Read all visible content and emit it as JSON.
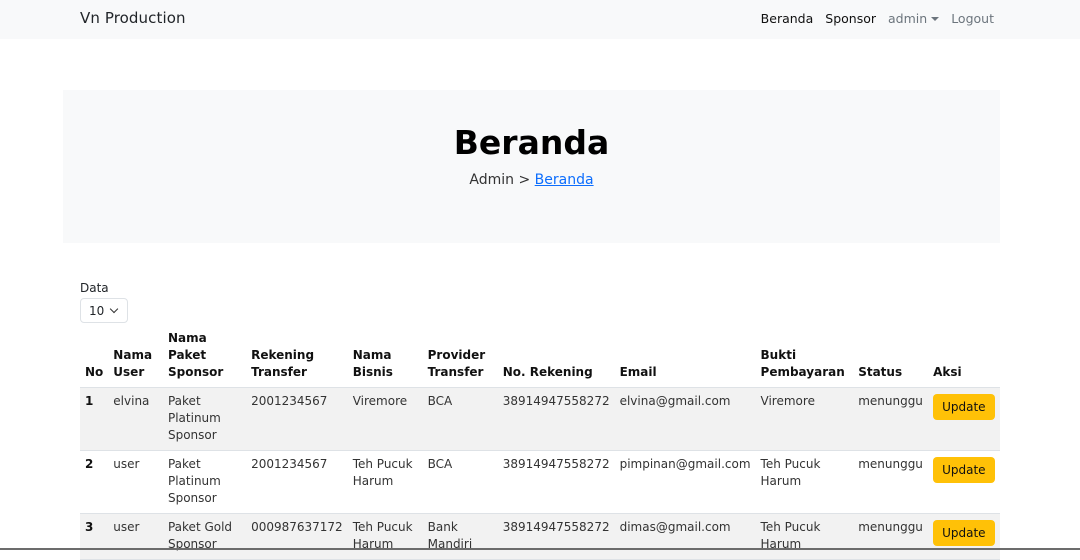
{
  "navbar": {
    "brand": "Vn Production",
    "links": {
      "beranda": "Beranda",
      "sponsor": "Sponsor",
      "admin": "admin",
      "logout": "Logout"
    }
  },
  "hero": {
    "title": "Beranda",
    "breadcrumb_root": "Admin",
    "breadcrumb_sep": " > ",
    "breadcrumb_current": "Beranda"
  },
  "table_controls": {
    "data_label": "Data",
    "page_size": "10"
  },
  "table": {
    "headers": [
      "No",
      "Nama User",
      "Nama Paket Sponsor",
      "Rekening Transfer",
      "Nama Bisnis",
      "Provider Transfer",
      "No. Rekening",
      "Email",
      "Bukti Pembayaran",
      "Status",
      "Aksi"
    ],
    "rows": [
      {
        "no": "1",
        "user": "elvina",
        "paket": "Paket Platinum Sponsor",
        "rekening": "2001234567",
        "bisnis": "Viremore",
        "provider": "BCA",
        "no_rek": "38914947558272",
        "email": "elvina@gmail.com",
        "bukti": "Viremore",
        "status": "menunggu",
        "aksi": "Update"
      },
      {
        "no": "2",
        "user": "user",
        "paket": "Paket Platinum Sponsor",
        "rekening": "2001234567",
        "bisnis": "Teh Pucuk Harum",
        "provider": "BCA",
        "no_rek": "38914947558272",
        "email": "pimpinan@gmail.com",
        "bukti": "Teh Pucuk Harum",
        "status": "menunggu",
        "aksi": "Update"
      },
      {
        "no": "3",
        "user": "user",
        "paket": "Paket Gold Sponsor",
        "rekening": "000987637172",
        "bisnis": "Teh Pucuk Harum",
        "provider": "Bank Mandiri",
        "no_rek": "38914947558272",
        "email": "dimas@gmail.com",
        "bukti": "Teh Pucuk Harum",
        "status": "menunggu",
        "aksi": "Update"
      }
    ]
  },
  "colors": {
    "accent_button": "#ffc107",
    "link": "#0d6efd",
    "hero_bg": "#f8f9fa"
  }
}
